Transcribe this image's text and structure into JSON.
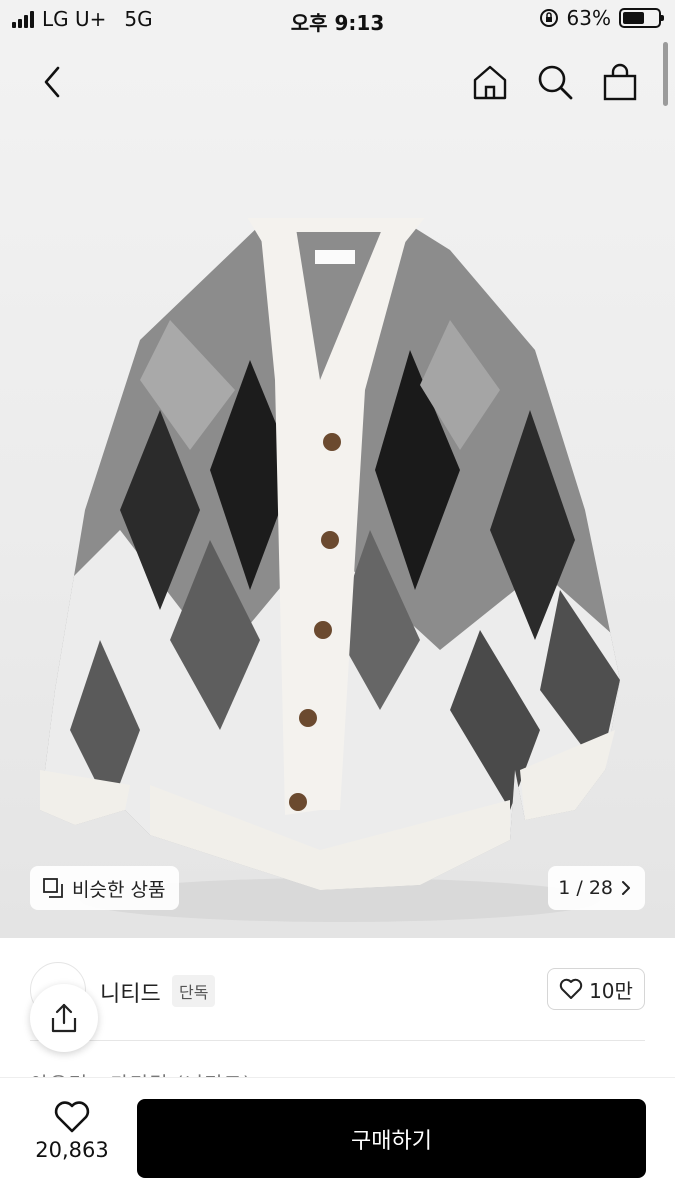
{
  "status_bar": {
    "carrier": "LG U+",
    "network": "5G",
    "time": "오후 9:13",
    "battery_percent_text": "63%",
    "battery_level": 0.63
  },
  "nav": {
    "back_icon": "chevron-left-icon",
    "home_icon": "home-icon",
    "search_icon": "search-icon",
    "cart_icon": "shopping-bag-icon"
  },
  "gallery": {
    "similar_label": "비슷한 상품",
    "pager": "1 / 28"
  },
  "product": {
    "brand": "니티드",
    "badge": "단독",
    "likes": "10만",
    "name_peek": "아우터 · 가디건 (니티드)"
  },
  "bottom": {
    "wish_count": "20,863",
    "buy_label": "구매하기"
  },
  "colors": {
    "accent": "#000000",
    "hero_bg": "#eeeeee"
  }
}
